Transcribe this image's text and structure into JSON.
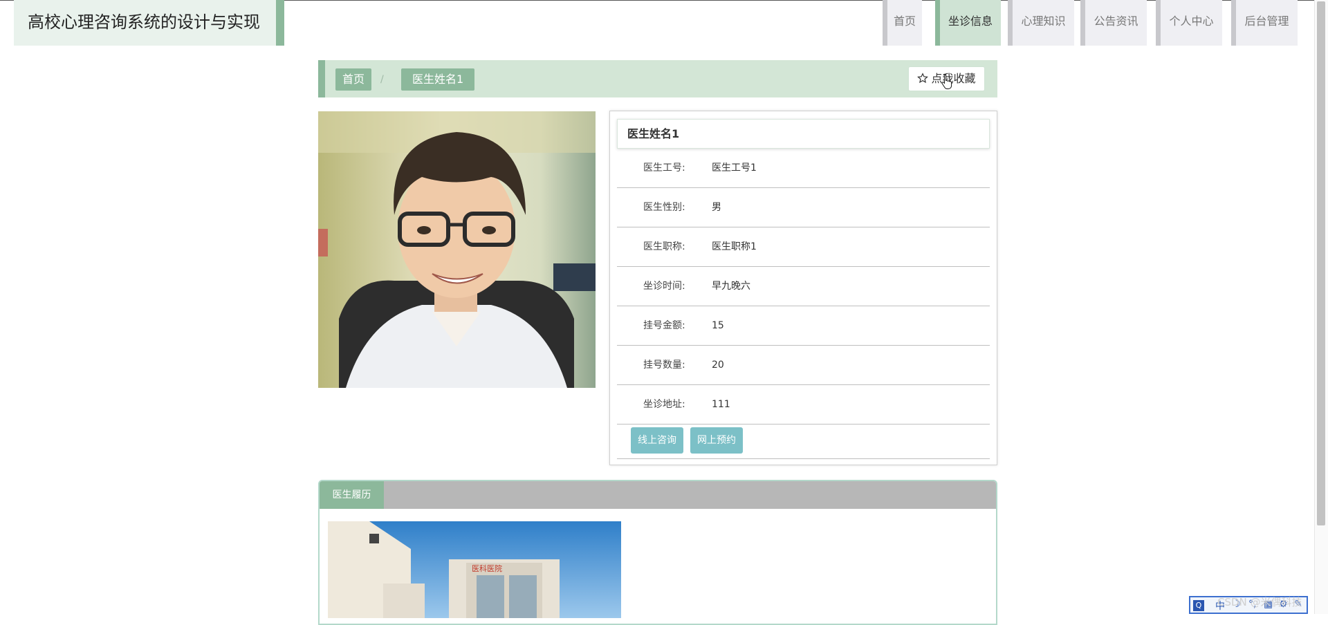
{
  "header": {
    "site_title": "高校心理咨询系统的设计与实现",
    "nav": [
      {
        "label": "首页",
        "active": false
      },
      {
        "label": "坐诊信息",
        "active": true
      },
      {
        "label": "心理知识",
        "active": false
      },
      {
        "label": "公告资讯",
        "active": false
      },
      {
        "label": "个人中心",
        "active": false
      },
      {
        "label": "后台管理",
        "active": false
      }
    ]
  },
  "breadcrumb": {
    "home": "首页",
    "separator": "/",
    "current": "医生姓名1"
  },
  "favorite_button": {
    "label": "点我收藏",
    "icon": "star-icon"
  },
  "doctor": {
    "name": "医生姓名1",
    "fields": [
      {
        "label": "医生工号:",
        "value": "医生工号1"
      },
      {
        "label": "医生性别:",
        "value": "男"
      },
      {
        "label": "医生职称:",
        "value": "医生职称1"
      },
      {
        "label": "坐诊时间:",
        "value": "早九晚六"
      },
      {
        "label": "挂号金额:",
        "value": "15"
      },
      {
        "label": "挂号数量:",
        "value": "20"
      },
      {
        "label": "坐诊地址:",
        "value": "111"
      }
    ],
    "actions": {
      "consult": "线上咨询",
      "reserve": "网上预约"
    }
  },
  "resume": {
    "tab_label": "医生履历",
    "sign_text": "医科医院"
  },
  "watermark": "CSDN @米偶科技",
  "tray": {
    "ime": "中"
  },
  "colors": {
    "accent_green": "#8cb89b",
    "light_green": "#d3e6d6",
    "action_teal": "#7cc0c7"
  }
}
